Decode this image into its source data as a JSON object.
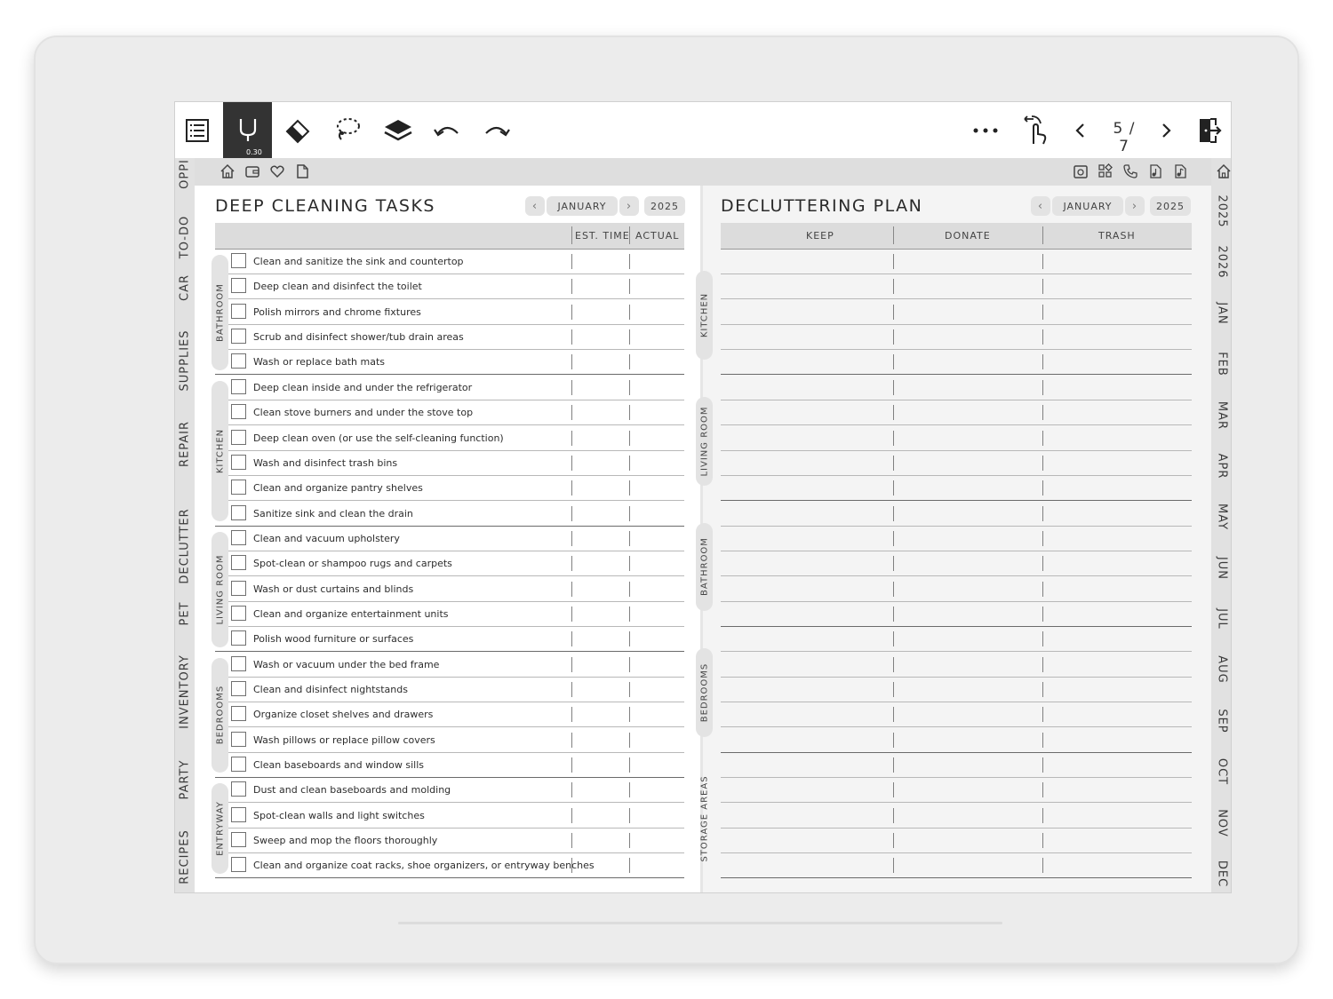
{
  "toolbar": {
    "icons": [
      "menu-icon",
      "pen-icon",
      "eraser-icon",
      "lasso-icon",
      "layers-icon",
      "undo-icon",
      "redo-icon",
      "more-icon",
      "touch-icon",
      "prev-page-icon",
      "next-page-icon",
      "exit-icon"
    ],
    "pen_size": "0.30",
    "page_indicator": "5 / 7"
  },
  "left_tabs": [
    "OPPI",
    "TO-DO",
    "CAR",
    "SUPPLIES",
    "REPAIR",
    "DECLUTTER",
    "PET",
    "INVENTORY",
    "PARTY",
    "RECIPES"
  ],
  "right_tabs": [
    "2025",
    "2026",
    "JAN",
    "FEB",
    "MAR",
    "APR",
    "MAY",
    "JUN",
    "JUL",
    "AUG",
    "SEP",
    "OCT",
    "NOV",
    "DEC"
  ],
  "nav_icons_left": [
    "home-icon",
    "wallet-icon",
    "heart-icon",
    "note-icon"
  ],
  "nav_icons_right": [
    "camera-icon",
    "grid-icon",
    "phone-icon",
    "music-1-icon",
    "music-2-icon",
    "home-right-icon"
  ],
  "deep_cleaning": {
    "title": "DEEP CLEANING TASKS",
    "month": "JANUARY",
    "year": "2025",
    "columns": {
      "est_time": "EST. TIME",
      "actual": "ACTUAL"
    },
    "groups": [
      {
        "name": "BATHROOM",
        "tasks": [
          "Clean and sanitize the sink and countertop",
          "Deep clean and disinfect the toilet",
          "Polish mirrors and chrome fixtures",
          "Scrub and disinfect shower/tub drain areas",
          "Wash or replace bath mats"
        ]
      },
      {
        "name": "KITCHEN",
        "tasks": [
          "Deep clean inside and under the refrigerator",
          "Clean stove burners and under the stove top",
          "Deep clean oven (or use the self-cleaning function)",
          "Wash and disinfect trash bins",
          "Clean and organize pantry shelves",
          "Sanitize sink and clean the drain"
        ]
      },
      {
        "name": "LIVING ROOM",
        "tasks": [
          "Clean and vacuum upholstery",
          "Spot-clean or shampoo rugs and carpets",
          "Wash or dust curtains and blinds",
          "Clean and organize entertainment units",
          "Polish wood furniture or surfaces"
        ]
      },
      {
        "name": "BEDROOMS",
        "tasks": [
          "Wash or vacuum under the bed frame",
          "Clean and disinfect nightstands",
          "Organize closet shelves and drawers",
          "Wash pillows or replace pillow covers",
          "Clean baseboards and window sills"
        ]
      },
      {
        "name": "ENTRYWAY",
        "tasks": [
          "Dust and clean baseboards and molding",
          "Spot-clean walls and light switches",
          "Sweep and mop the floors thoroughly",
          "Clean and organize coat racks, shoe organizers, or entryway benches"
        ]
      }
    ]
  },
  "decluttering": {
    "title": "DECLUTTERING PLAN",
    "month": "JANUARY",
    "year": "2025",
    "columns": [
      "KEEP",
      "DONATE",
      "TRASH"
    ],
    "groups": [
      {
        "name": "KITCHEN",
        "rows": 5
      },
      {
        "name": "LIVING ROOM",
        "rows": 5
      },
      {
        "name": "BATHROOM",
        "rows": 5
      },
      {
        "name": "BEDROOMS",
        "rows": 5
      },
      {
        "name": "STORAGE AREAS",
        "rows": 5
      }
    ]
  }
}
